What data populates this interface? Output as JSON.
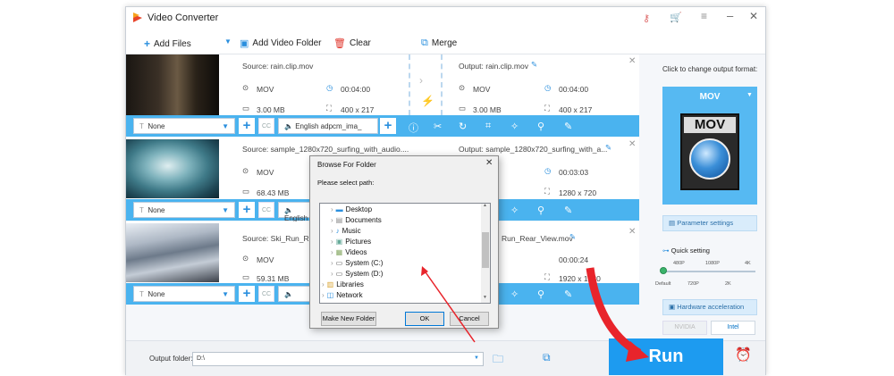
{
  "app": {
    "title": "Video Converter"
  },
  "toolbar": {
    "add_files": "Add Files",
    "add_folder": "Add Video Folder",
    "clear": "Clear",
    "merge": "Merge"
  },
  "rows": [
    {
      "source": "Source: rain.clip.mov",
      "output": "Output: rain.clip.mov",
      "format": "MOV",
      "duration": "00:04:00",
      "size": "3.00 MB",
      "resolution": "400 x 217",
      "out_format": "MOV",
      "out_duration": "00:04:00",
      "out_size": "3.00 MB",
      "out_resolution": "400 x 217",
      "subtitle": "None",
      "audio": "English adpcm_ima_"
    },
    {
      "source": "Source: sample_1280x720_surfing_with_audio....",
      "output": "Output: sample_1280x720_surfing_with_a...",
      "format": "MOV",
      "size": "68.43 MB",
      "out_duration": "00:03:03",
      "out_resolution": "1280 x 720",
      "subtitle": "None",
      "audio": "English"
    },
    {
      "source": "Source: Ski_Run_Rear",
      "output": "Run_Rear_View.mov",
      "format": "MOV",
      "size": "59.31 MB",
      "out_duration": "00:00:24",
      "out_resolution": "1920 x 1080",
      "subtitle": "None"
    }
  ],
  "right_panel": {
    "hint": "Click to change output format:",
    "format": "MOV",
    "icon_text": "MOV",
    "param_settings": "Parameter settings",
    "quick_setting": "Quick setting",
    "slider_top": [
      "480P",
      "1080P",
      "4K"
    ],
    "slider_bottom": [
      "Default",
      "720P",
      "2K"
    ],
    "hw_accel": "Hardware acceleration",
    "nvidia": "NVIDIA",
    "intel": "Intel"
  },
  "bottom": {
    "output_label": "Output folder:",
    "output_value": "D:\\",
    "run": "Run"
  },
  "dialog": {
    "title": "Browse For Folder",
    "prompt": "Please select path:",
    "items": [
      "Desktop",
      "Documents",
      "Music",
      "Pictures",
      "Videos",
      "System (C:)",
      "System (D:)",
      "Libraries",
      "Network"
    ],
    "new_folder": "Make New Folder",
    "ok": "OK",
    "cancel": "Cancel"
  },
  "colors": {
    "accent": "#1d9bf0",
    "ctrl_bar": "#4ab3ef",
    "arrow": "#e8242b"
  }
}
